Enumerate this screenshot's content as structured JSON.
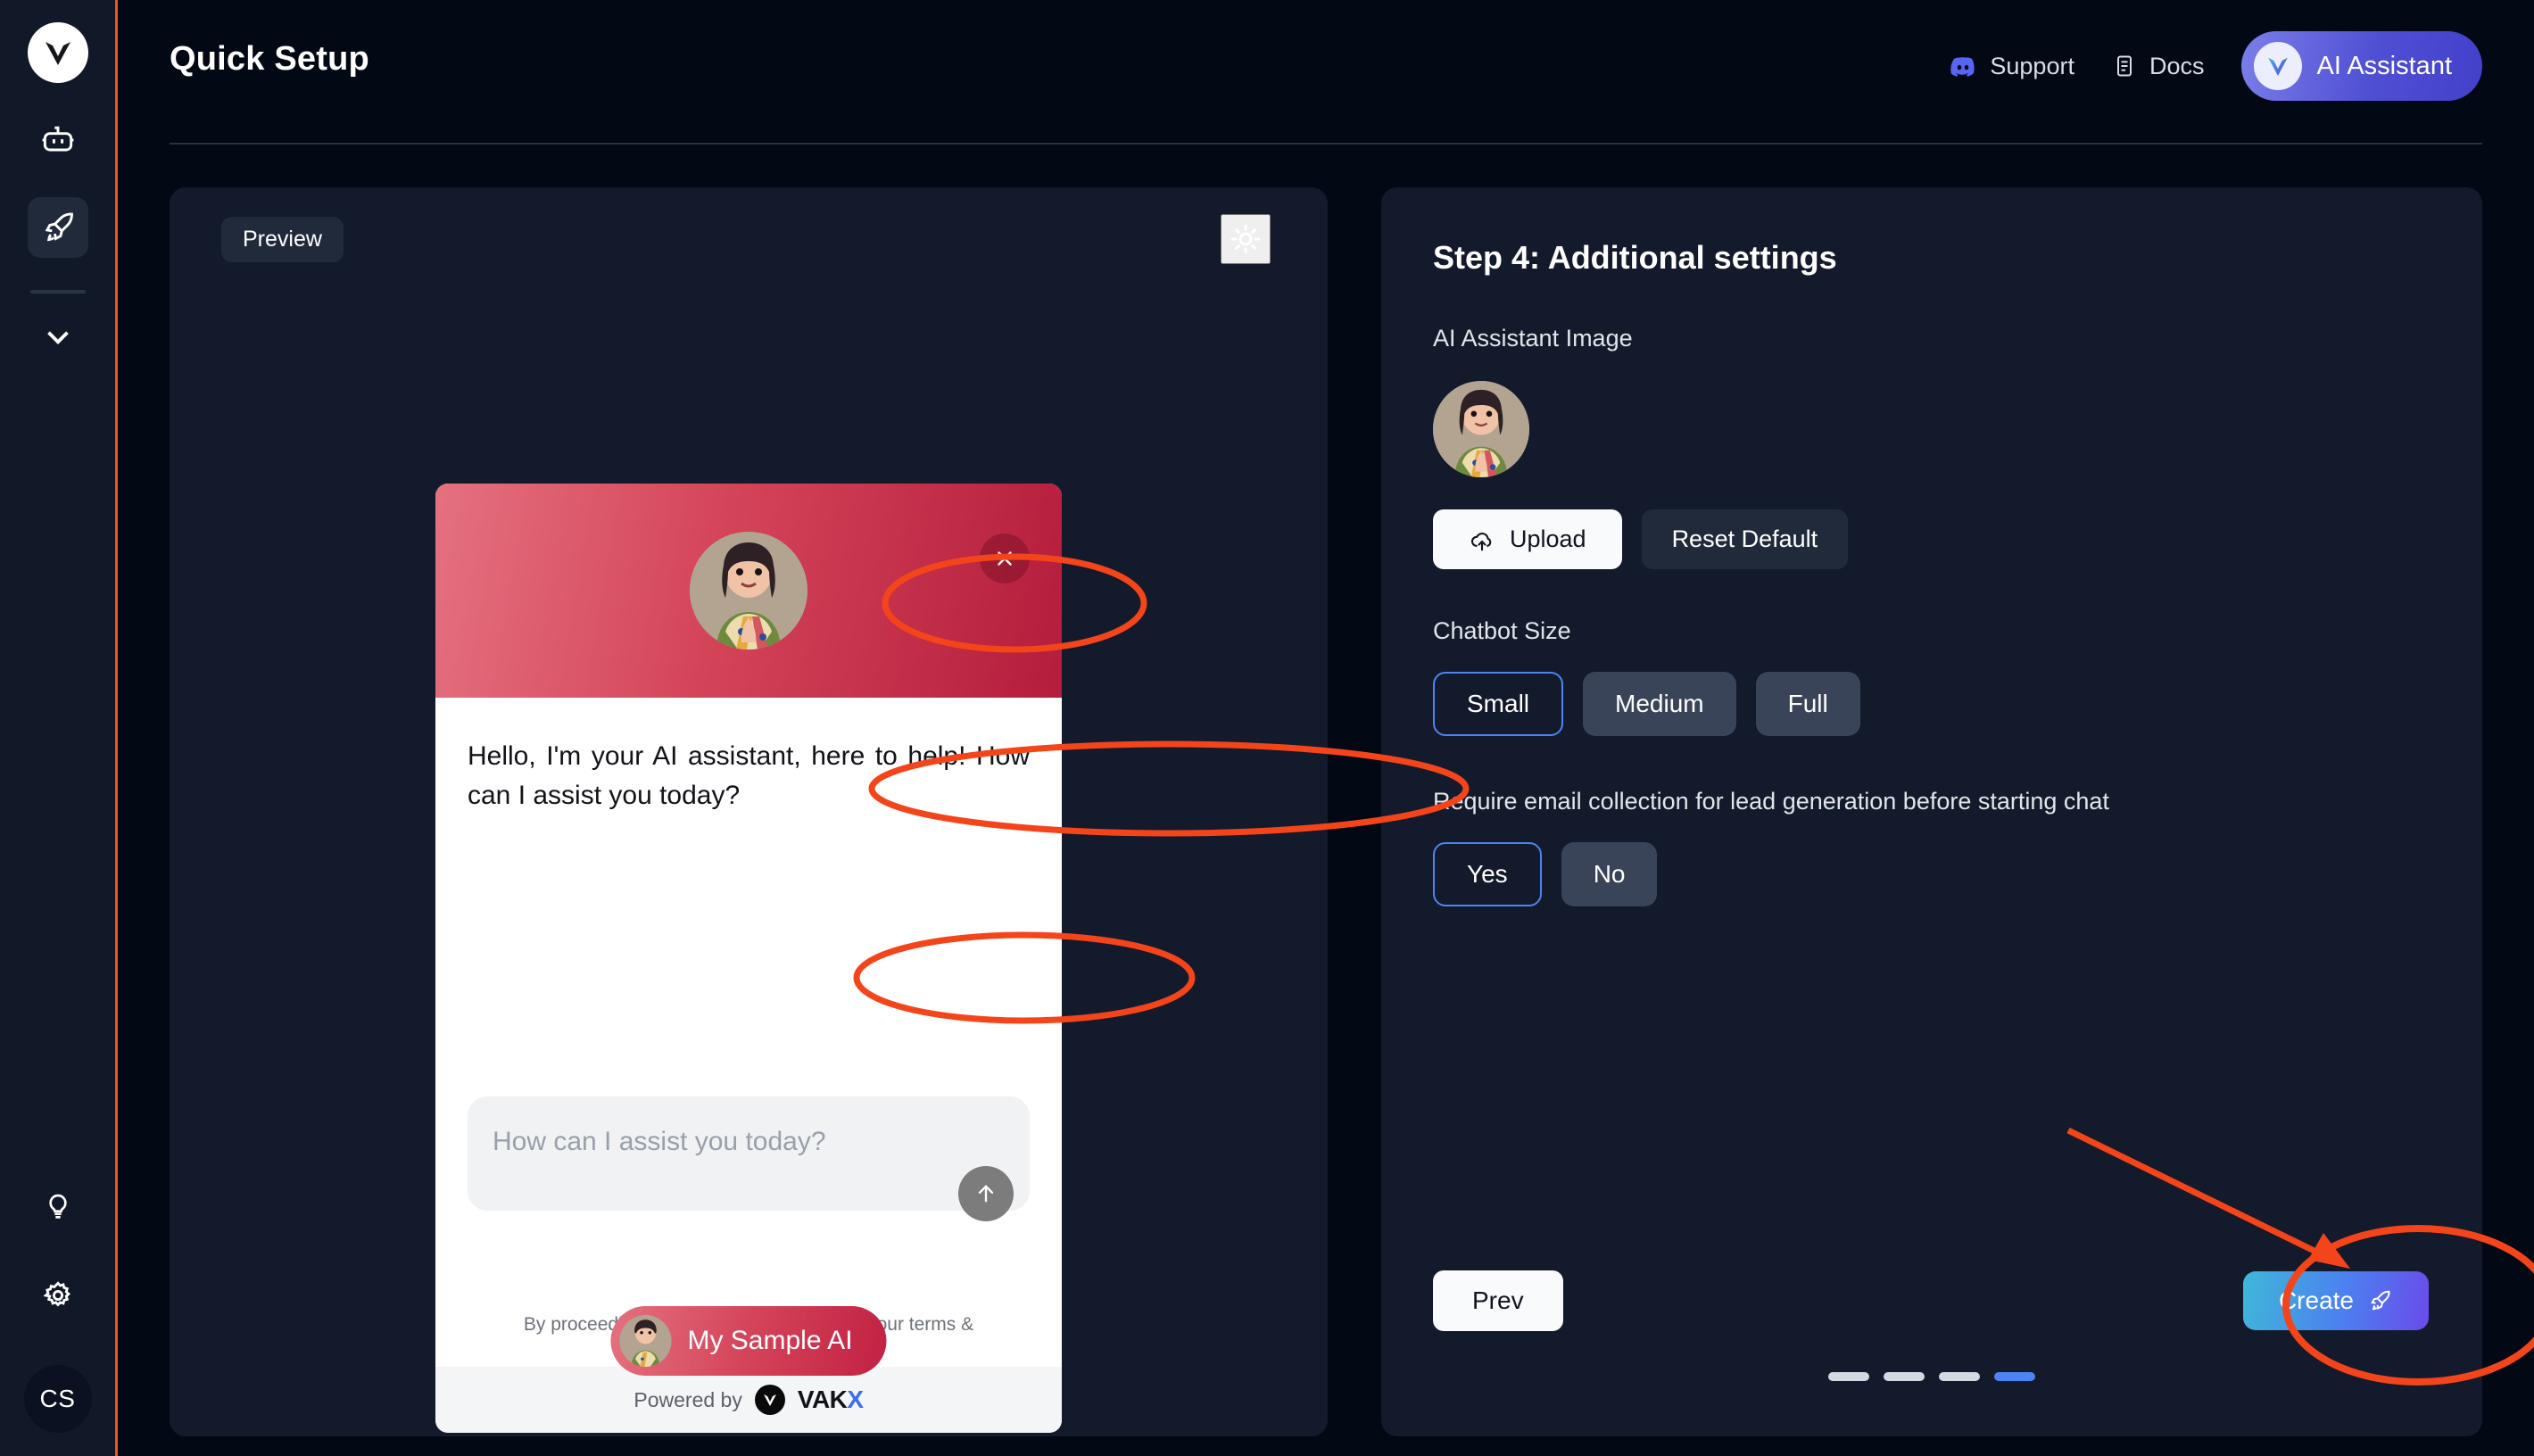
{
  "app": {
    "title": "Quick Setup",
    "logo_icon": "vakx-chevron-logo",
    "sidebar_accent_color": "#f4501e",
    "background_color": "#020814",
    "card_color": "#131a2b"
  },
  "sidebar": {
    "items": [
      {
        "icon": "robot-icon",
        "label": "Chatbots",
        "active": false
      },
      {
        "icon": "rocket-icon",
        "label": "Quick Setup",
        "active": true
      },
      {
        "icon": "chevron-down-icon",
        "label": "Expand",
        "active": false
      }
    ],
    "bottom_items": [
      {
        "icon": "lightbulb-icon",
        "label": "Ideas"
      },
      {
        "icon": "gear-icon",
        "label": "Settings"
      }
    ],
    "avatar_initials": "CS"
  },
  "topbar": {
    "support_label": "Support",
    "support_icon": "discord-icon",
    "docs_label": "Docs",
    "docs_icon": "document-icon",
    "ai_assistant_label": "AI Assistant",
    "ai_assistant_icon": "vakx-chevron-logo",
    "ai_assistant_gradient": "#4f4fd4"
  },
  "preview": {
    "pill_label": "Preview",
    "theme_toggle_icon": "sun-icon",
    "widget": {
      "close_icon": "close-icon",
      "avatar_icon": "assistant-avatar",
      "header_gradient_from": "#e4717f",
      "header_gradient_to": "#b41d3c",
      "bot_message": "Hello, I'm your AI assistant, here to help! How can I assist you today?",
      "input_placeholder": "How can I assist you today?",
      "send_icon": "arrow-up-icon",
      "disclaimer": "By proceeding with this chat, you agree to our terms & conditions and privacy policy.",
      "powered_by_label": "Powered by",
      "brand_name": "VAKX"
    },
    "launcher_label": "My Sample AI"
  },
  "settings": {
    "step_title": "Step 4: Additional settings",
    "image_label": "AI Assistant Image",
    "upload_label": "Upload",
    "upload_icon": "cloud-upload-icon",
    "reset_label": "Reset Default",
    "size_label": "Chatbot Size",
    "size_options": [
      {
        "label": "Small",
        "selected": true
      },
      {
        "label": "Medium",
        "selected": false
      },
      {
        "label": "Full",
        "selected": false
      }
    ],
    "email_label": "Require email collection for lead generation before starting chat",
    "email_options": [
      {
        "label": "Yes",
        "selected": true
      },
      {
        "label": "No",
        "selected": false
      }
    ],
    "prev_label": "Prev",
    "create_label": "Create",
    "create_icon": "rocket-icon",
    "steps_total": 4,
    "current_step": 4,
    "selected_color": "#4c84f5"
  },
  "annotations": {
    "color": "#f4441a",
    "shapes": [
      "ellipse-upload",
      "ellipse-chatbot-size",
      "ellipse-email-toggle",
      "ellipse-create",
      "arrow-to-create"
    ]
  }
}
